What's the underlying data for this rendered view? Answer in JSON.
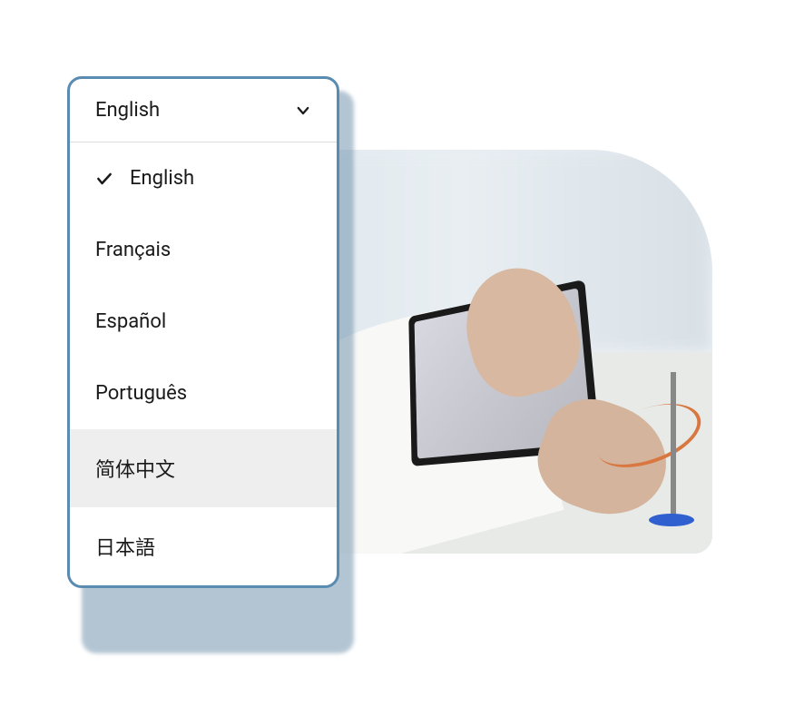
{
  "dropdown": {
    "selected": "English",
    "options": [
      {
        "label": "English",
        "selected": true,
        "hovered": false
      },
      {
        "label": "Français",
        "selected": false,
        "hovered": false
      },
      {
        "label": "Español",
        "selected": false,
        "hovered": false
      },
      {
        "label": "Português",
        "selected": false,
        "hovered": false
      },
      {
        "label": "简体中文",
        "selected": false,
        "hovered": true
      },
      {
        "label": "日本語",
        "selected": false,
        "hovered": false
      }
    ]
  }
}
